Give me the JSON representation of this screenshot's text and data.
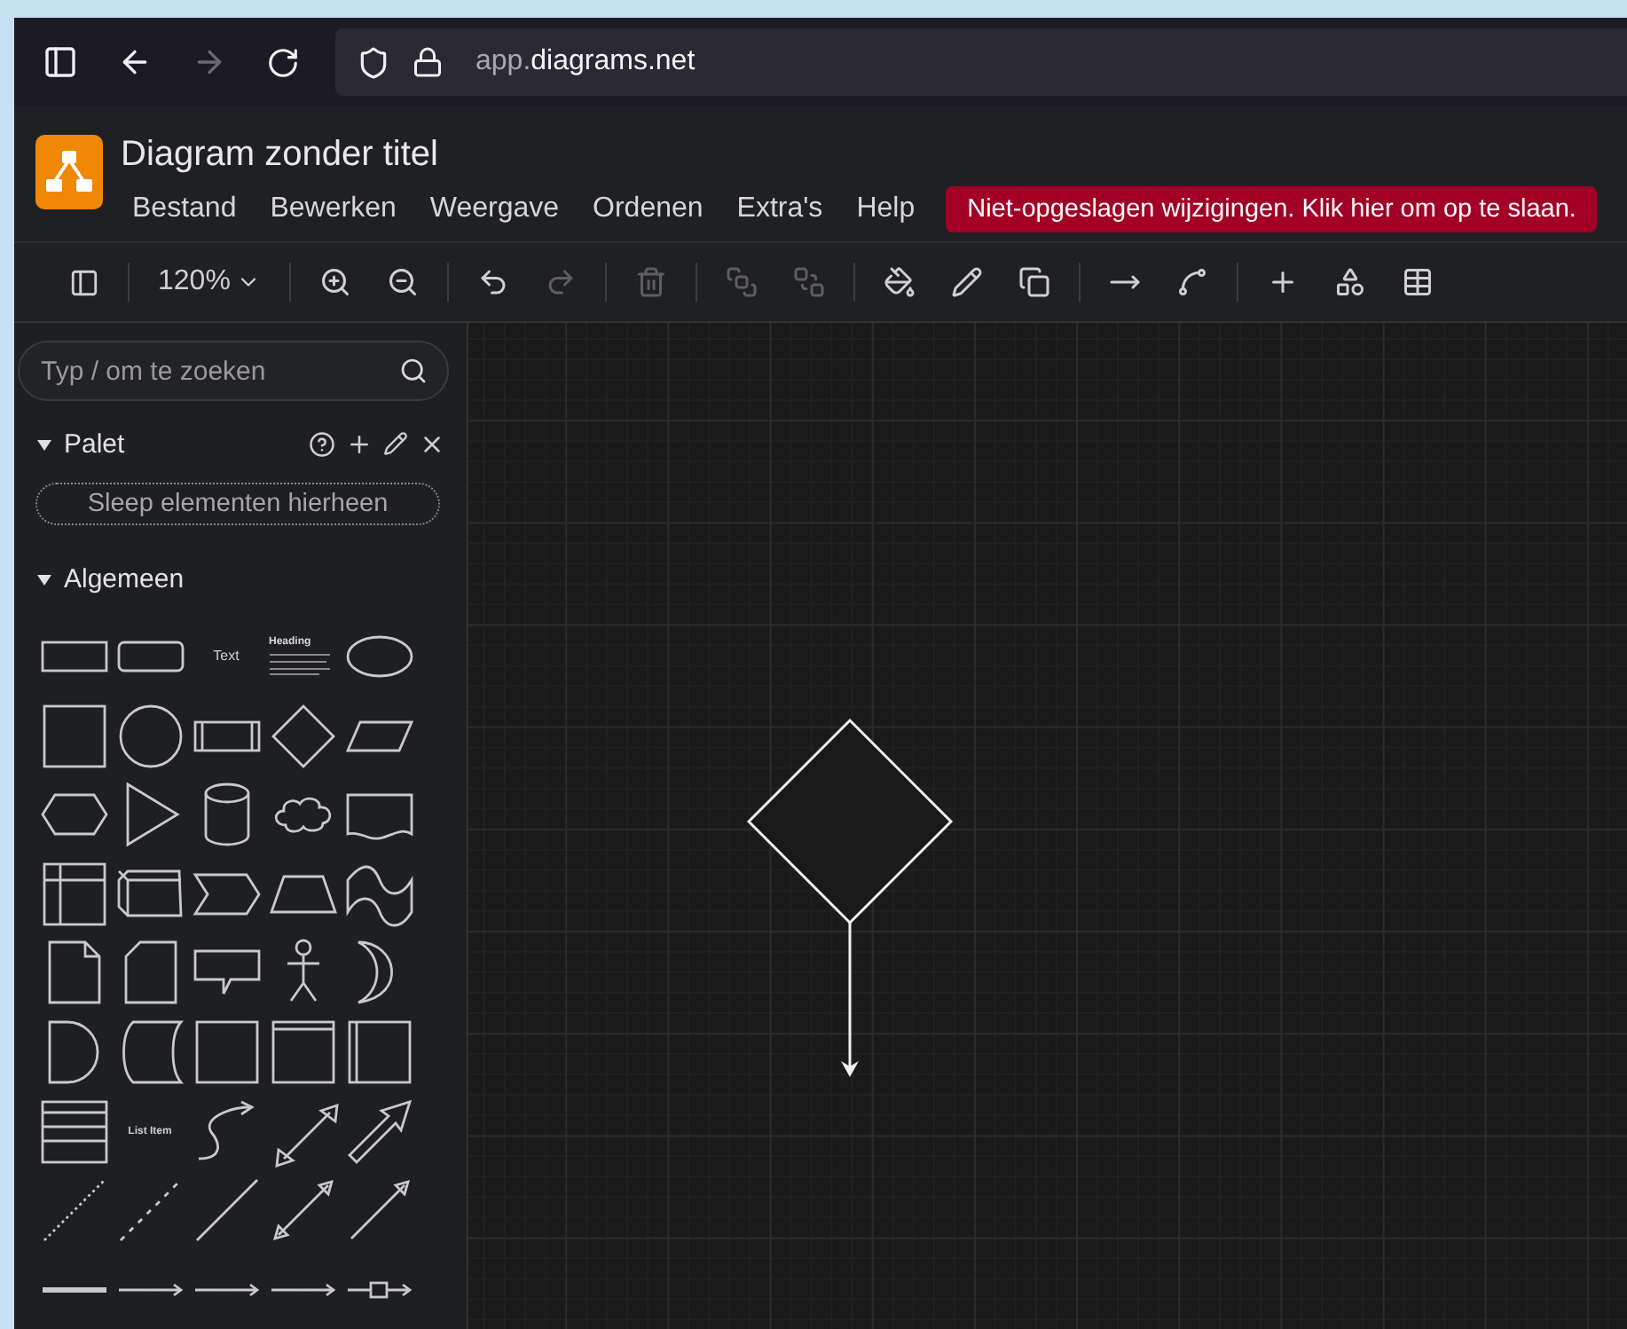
{
  "browser": {
    "url": {
      "subdomain": "app.",
      "domain": "diagrams.net"
    },
    "forward_disabled": true
  },
  "app": {
    "title": "Diagram zonder titel",
    "menus": [
      "Bestand",
      "Bewerken",
      "Weergave",
      "Ordenen",
      "Extra's",
      "Help"
    ],
    "unsaved_notice": "Niet-opgeslagen wijzigingen. Klik hier om op te slaan."
  },
  "toolbar": {
    "zoom": "120%",
    "tools": [
      {
        "kind": "zoomin",
        "disabled": false
      },
      {
        "kind": "zoomout",
        "disabled": false
      },
      {
        "kind": "undo",
        "disabled": false
      },
      {
        "kind": "redo",
        "disabled": true
      },
      {
        "kind": "delete",
        "disabled": true
      },
      {
        "kind": "tofront",
        "disabled": true
      },
      {
        "kind": "toback",
        "disabled": true
      },
      {
        "kind": "fill",
        "disabled": false
      },
      {
        "kind": "linecolor",
        "disabled": false
      },
      {
        "kind": "shadow",
        "disabled": false
      },
      {
        "kind": "connection",
        "disabled": false
      },
      {
        "kind": "waypoints",
        "disabled": false
      },
      {
        "kind": "insert",
        "disabled": false
      },
      {
        "kind": "shapes",
        "disabled": false
      },
      {
        "kind": "table",
        "disabled": false
      }
    ]
  },
  "sidebar": {
    "search": {
      "placeholder": "Typ / om te zoeken"
    },
    "palette": {
      "title": "Palet",
      "expanded": true,
      "dropzone": "Sleep elementen hierheen"
    },
    "general": {
      "title": "Algemeen",
      "expanded": true,
      "shapes": [
        {
          "kind": "rect"
        },
        {
          "kind": "rounded"
        },
        {
          "kind": "text",
          "label": "Text"
        },
        {
          "kind": "heading",
          "label": "Heading"
        },
        {
          "kind": "ellipse"
        },
        {
          "kind": "square"
        },
        {
          "kind": "circle"
        },
        {
          "kind": "process"
        },
        {
          "kind": "diamond"
        },
        {
          "kind": "parallelogram"
        },
        {
          "kind": "hexagon"
        },
        {
          "kind": "triangle"
        },
        {
          "kind": "cylinder"
        },
        {
          "kind": "cloud"
        },
        {
          "kind": "document"
        },
        {
          "kind": "storage"
        },
        {
          "kind": "cube"
        },
        {
          "kind": "step"
        },
        {
          "kind": "trapezoid"
        },
        {
          "kind": "tape"
        },
        {
          "kind": "note"
        },
        {
          "kind": "card"
        },
        {
          "kind": "callout"
        },
        {
          "kind": "actor"
        },
        {
          "kind": "crescent"
        },
        {
          "kind": "delay"
        },
        {
          "kind": "datastore"
        },
        {
          "kind": "container"
        },
        {
          "kind": "window"
        },
        {
          "kind": "swimlane"
        },
        {
          "kind": "list"
        },
        {
          "kind": "listitem",
          "label": "List Item"
        },
        {
          "kind": "curve"
        },
        {
          "kind": "doublearrow"
        },
        {
          "kind": "bigarrow"
        },
        {
          "kind": "dotted"
        },
        {
          "kind": "dashed"
        },
        {
          "kind": "line"
        },
        {
          "kind": "bidirectional"
        },
        {
          "kind": "directional"
        },
        {
          "kind": "thick"
        },
        {
          "kind": "connector"
        },
        {
          "kind": "connector"
        },
        {
          "kind": "connector"
        },
        {
          "kind": "symbolconnector"
        }
      ]
    }
  }
}
